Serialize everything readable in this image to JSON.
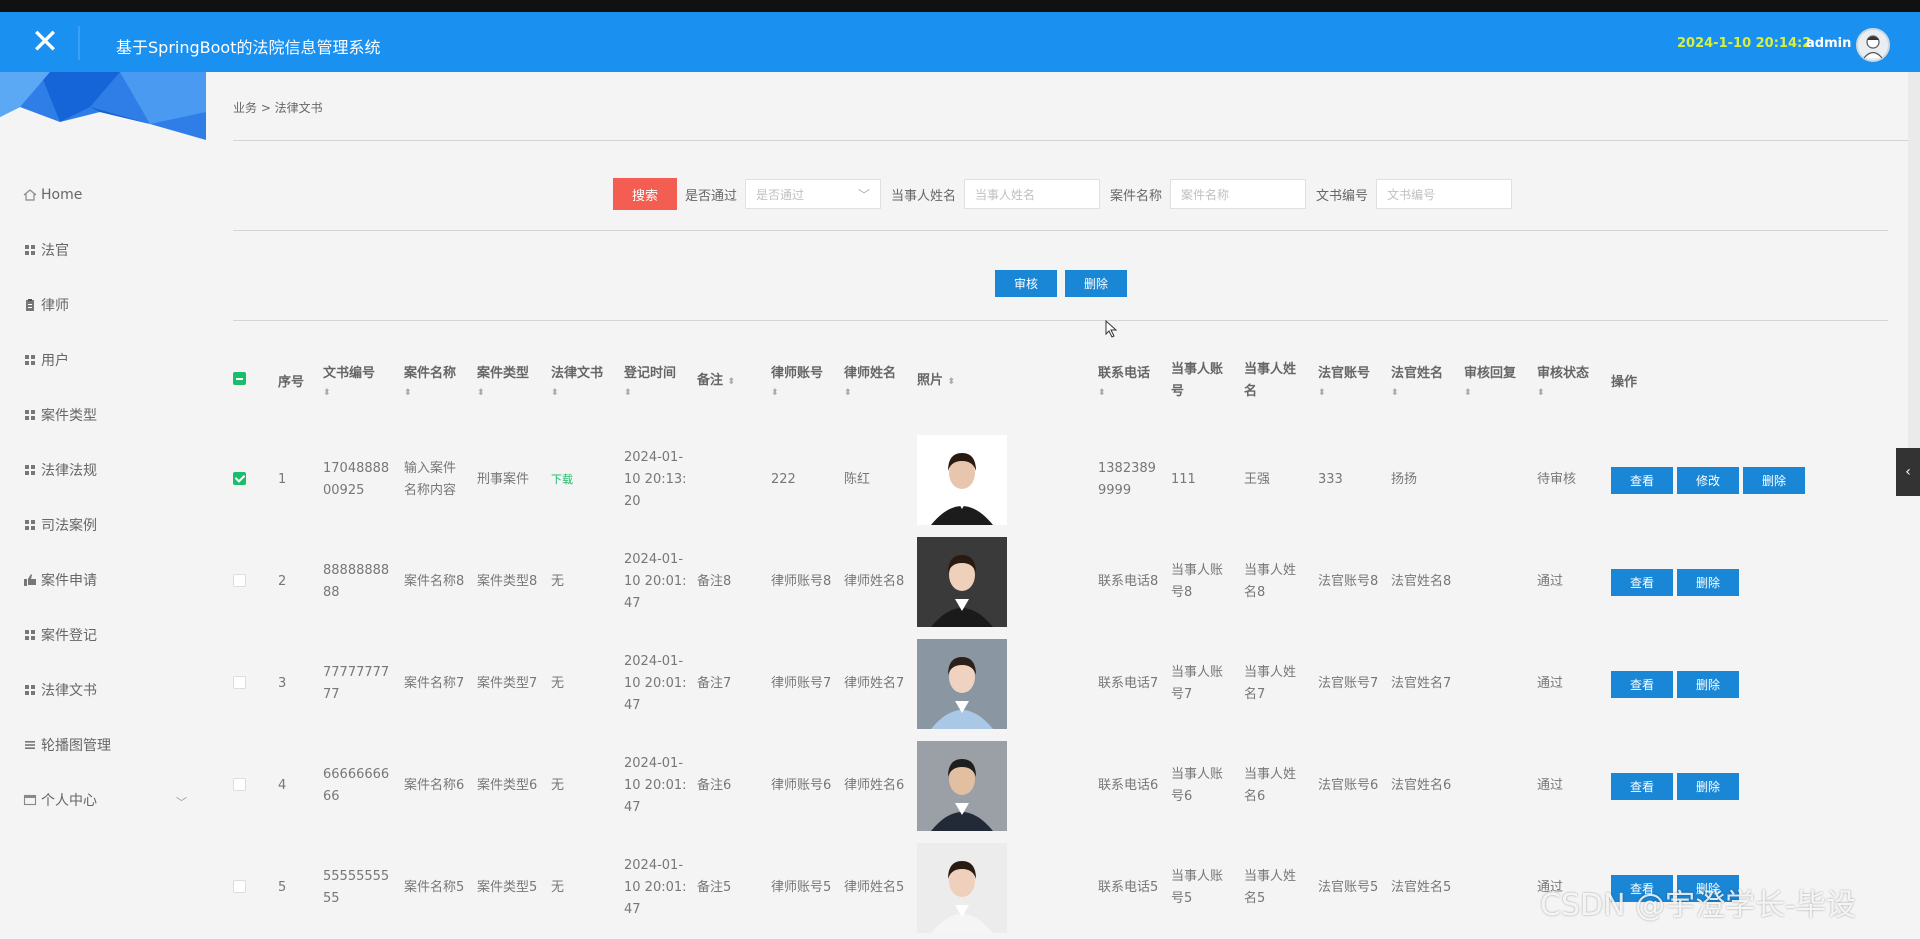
{
  "header": {
    "title": "基于SpringBoot的法院信息管理系统",
    "time": "2024-1-10 20:14:2",
    "user": "admin",
    "bg_color": "#1a90f0"
  },
  "sidebar": {
    "items": [
      {
        "label": "Home",
        "icon": "home-icon"
      },
      {
        "label": "法官",
        "icon": "grid-icon"
      },
      {
        "label": "律师",
        "icon": "clipboard-icon"
      },
      {
        "label": "用户",
        "icon": "grid-icon"
      },
      {
        "label": "案件类型",
        "icon": "grid-icon"
      },
      {
        "label": "法律法规",
        "icon": "grid-icon"
      },
      {
        "label": "司法案例",
        "icon": "grid-icon"
      },
      {
        "label": "案件申请",
        "icon": "thumb-icon"
      },
      {
        "label": "案件登记",
        "icon": "grid-icon"
      },
      {
        "label": "法律文书",
        "icon": "grid-icon"
      },
      {
        "label": "轮播图管理",
        "icon": "list-icon"
      },
      {
        "label": "个人中心",
        "icon": "card-icon"
      }
    ]
  },
  "breadcrumb": "业务 > 法律文书",
  "search": {
    "button": "搜索",
    "approved_label": "是否通过",
    "approved_placeholder": "是否通过",
    "party_label": "当事人姓名",
    "party_placeholder": "当事人姓名",
    "case_label": "案件名称",
    "case_placeholder": "案件名称",
    "doc_label": "文书编号",
    "doc_placeholder": "文书编号"
  },
  "actions": {
    "audit": "审核",
    "delete": "删除"
  },
  "table": {
    "headers": [
      "序号",
      "文书编号",
      "案件名称",
      "案件类型",
      "法律文书",
      "登记时间",
      "备注",
      "律师账号",
      "律师姓名",
      "照片",
      "联系电话",
      "当事人账号",
      "当事人姓名",
      "法官账号",
      "法官姓名",
      "审核回复",
      "审核状态",
      "操作"
    ],
    "rows": [
      {
        "no": "1",
        "doc": "1704888800925",
        "case": "输入案件名称内容",
        "type": "刑事案件",
        "file": "下载",
        "time": "2024-01-10 20:13:20",
        "remark": "",
        "lawyer_acc": "222",
        "lawyer_name": "陈红",
        "phone": "13823899999",
        "party_acc": "111",
        "party_name": "王强",
        "judge_acc": "333",
        "judge_name": "扬扬",
        "reply": "",
        "status": "待审核",
        "checked": true,
        "ops": [
          "查看",
          "修改",
          "删除"
        ]
      },
      {
        "no": "2",
        "doc": "8888888888",
        "case": "案件名称8",
        "type": "案件类型8",
        "file": "无",
        "time": "2024-01-10 20:01:47",
        "remark": "备注8",
        "lawyer_acc": "律师账号8",
        "lawyer_name": "律师姓名8",
        "phone": "联系电话8",
        "party_acc": "当事人账号8",
        "party_name": "当事人姓名8",
        "judge_acc": "法官账号8",
        "judge_name": "法官姓名8",
        "reply": "",
        "status": "通过",
        "checked": false,
        "ops": [
          "查看",
          "删除"
        ]
      },
      {
        "no": "3",
        "doc": "7777777777",
        "case": "案件名称7",
        "type": "案件类型7",
        "file": "无",
        "time": "2024-01-10 20:01:47",
        "remark": "备注7",
        "lawyer_acc": "律师账号7",
        "lawyer_name": "律师姓名7",
        "phone": "联系电话7",
        "party_acc": "当事人账号7",
        "party_name": "当事人姓名7",
        "judge_acc": "法官账号7",
        "judge_name": "法官姓名7",
        "reply": "",
        "status": "通过",
        "checked": false,
        "ops": [
          "查看",
          "删除"
        ]
      },
      {
        "no": "4",
        "doc": "6666666666",
        "case": "案件名称6",
        "type": "案件类型6",
        "file": "无",
        "time": "2024-01-10 20:01:47",
        "remark": "备注6",
        "lawyer_acc": "律师账号6",
        "lawyer_name": "律师姓名6",
        "phone": "联系电话6",
        "party_acc": "当事人账号6",
        "party_name": "当事人姓名6",
        "judge_acc": "法官账号6",
        "judge_name": "法官姓名6",
        "reply": "",
        "status": "通过",
        "checked": false,
        "ops": [
          "查看",
          "删除"
        ]
      },
      {
        "no": "5",
        "doc": "5555555555",
        "case": "案件名称5",
        "type": "案件类型5",
        "file": "无",
        "time": "2024-01-10 20:01:47",
        "remark": "备注5",
        "lawyer_acc": "律师账号5",
        "lawyer_name": "律师姓名5",
        "phone": "联系电话5",
        "party_acc": "当事人账号5",
        "party_name": "当事人姓名5",
        "judge_acc": "法官账号5",
        "judge_name": "法官姓名5",
        "reply": "",
        "status": "通过",
        "checked": false,
        "ops": [
          "查看",
          "删除"
        ]
      }
    ]
  },
  "watermark": "CSDN @宇澄学长-毕设"
}
